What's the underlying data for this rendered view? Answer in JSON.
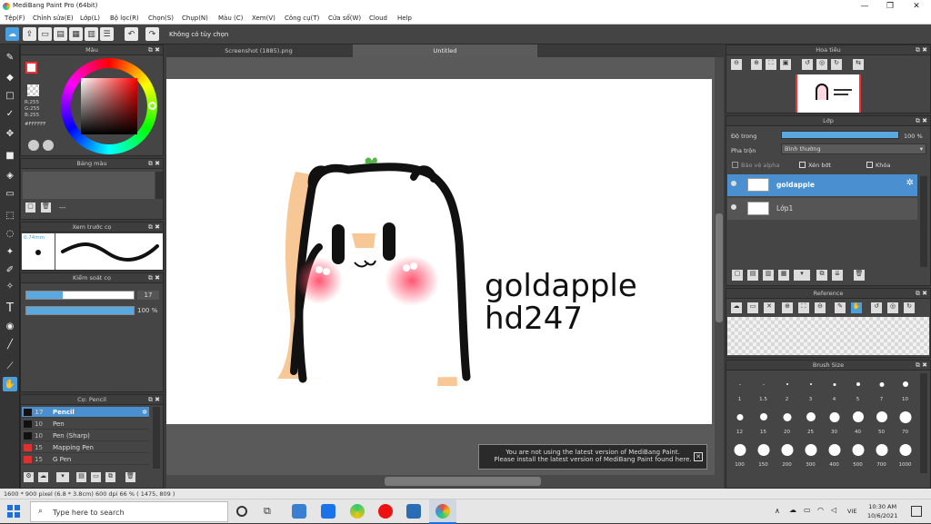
{
  "window": {
    "title": "MediBang Paint Pro (64bit)",
    "minimize": "—",
    "maximize": "❐",
    "close": "✕"
  },
  "menu": [
    "Tệp(F)",
    "Chỉnh sửa(E)",
    "Lớp(L)",
    "Bộ lọc(R)",
    "Chọn(S)",
    "Chụp(N)",
    "Màu (C)",
    "Xem(V)",
    "Công cụ(T)",
    "Cửa sổ(W)",
    "Cloud",
    "Help"
  ],
  "toolbar": {
    "hint": "Không có tùy chọn"
  },
  "tabs": [
    "Screenshot (1885).png",
    "Untitled"
  ],
  "color_panel": {
    "title": "Màu",
    "r": "R:255",
    "g": "G:255",
    "b": "B:255",
    "hex": "#FFFFFF"
  },
  "palette_panel": {
    "title": "Bảng màu",
    "placeholder": "---"
  },
  "brush_preview": {
    "title": "Xem trước cọ",
    "size": "0.74mm"
  },
  "brush_control": {
    "title": "Kiểm soát cọ",
    "size_value": "17",
    "opacity_value": "100 %"
  },
  "brush_list": {
    "title": "Cọ: Pencil",
    "items": [
      {
        "num": "17",
        "name": "Pencil",
        "color": "#111111",
        "selected": true
      },
      {
        "num": "10",
        "name": "Pen",
        "color": "#111111",
        "selected": false
      },
      {
        "num": "10",
        "name": "Pen (Sharp)",
        "color": "#111111",
        "selected": false
      },
      {
        "num": "15",
        "name": "Mapping Pen",
        "color": "#e03030",
        "selected": false
      },
      {
        "num": "15",
        "name": "G Pen",
        "color": "#e03030",
        "selected": false
      }
    ]
  },
  "navigator": {
    "title": "Hoa tiêu"
  },
  "layer_panel": {
    "title": "Lớp",
    "opacity_label": "Độ trong",
    "opacity_value": "100 %",
    "blend_label": "Pha trộn",
    "blend_value": "Bình thường",
    "protect_alpha": "Bảo vệ alpha",
    "clipping": "Xén bớt",
    "lock": "Khóa",
    "layers": [
      {
        "name": "goldapple",
        "selected": true
      },
      {
        "name": "Lớp1",
        "selected": false
      }
    ]
  },
  "reference_panel": {
    "title": "Reference"
  },
  "brush_size_panel": {
    "title": "Brush Size",
    "sizes": [
      "1",
      "1.5",
      "2",
      "3",
      "4",
      "5",
      "7",
      "10",
      "12",
      "15",
      "20",
      "25",
      "30",
      "40",
      "50",
      "70",
      "100",
      "150",
      "200",
      "300",
      "400",
      "500",
      "700",
      "1000"
    ]
  },
  "canvas_text": {
    "line1": "goldapple",
    "line2": "hd247"
  },
  "notification": {
    "line1": "You are not using the latest version of MediBang Paint.",
    "line2": "Please install the latest version of MediBang Paint found here."
  },
  "status": {
    "text": "1600 * 900 pixel   (6.8 * 3.8cm)   600 dpi   66 %   ( 1475, 809 )"
  },
  "taskbar": {
    "search_placeholder": "Type here to search",
    "lang": "VIE",
    "time": "10:30 AM",
    "date": "10/6/2021"
  }
}
